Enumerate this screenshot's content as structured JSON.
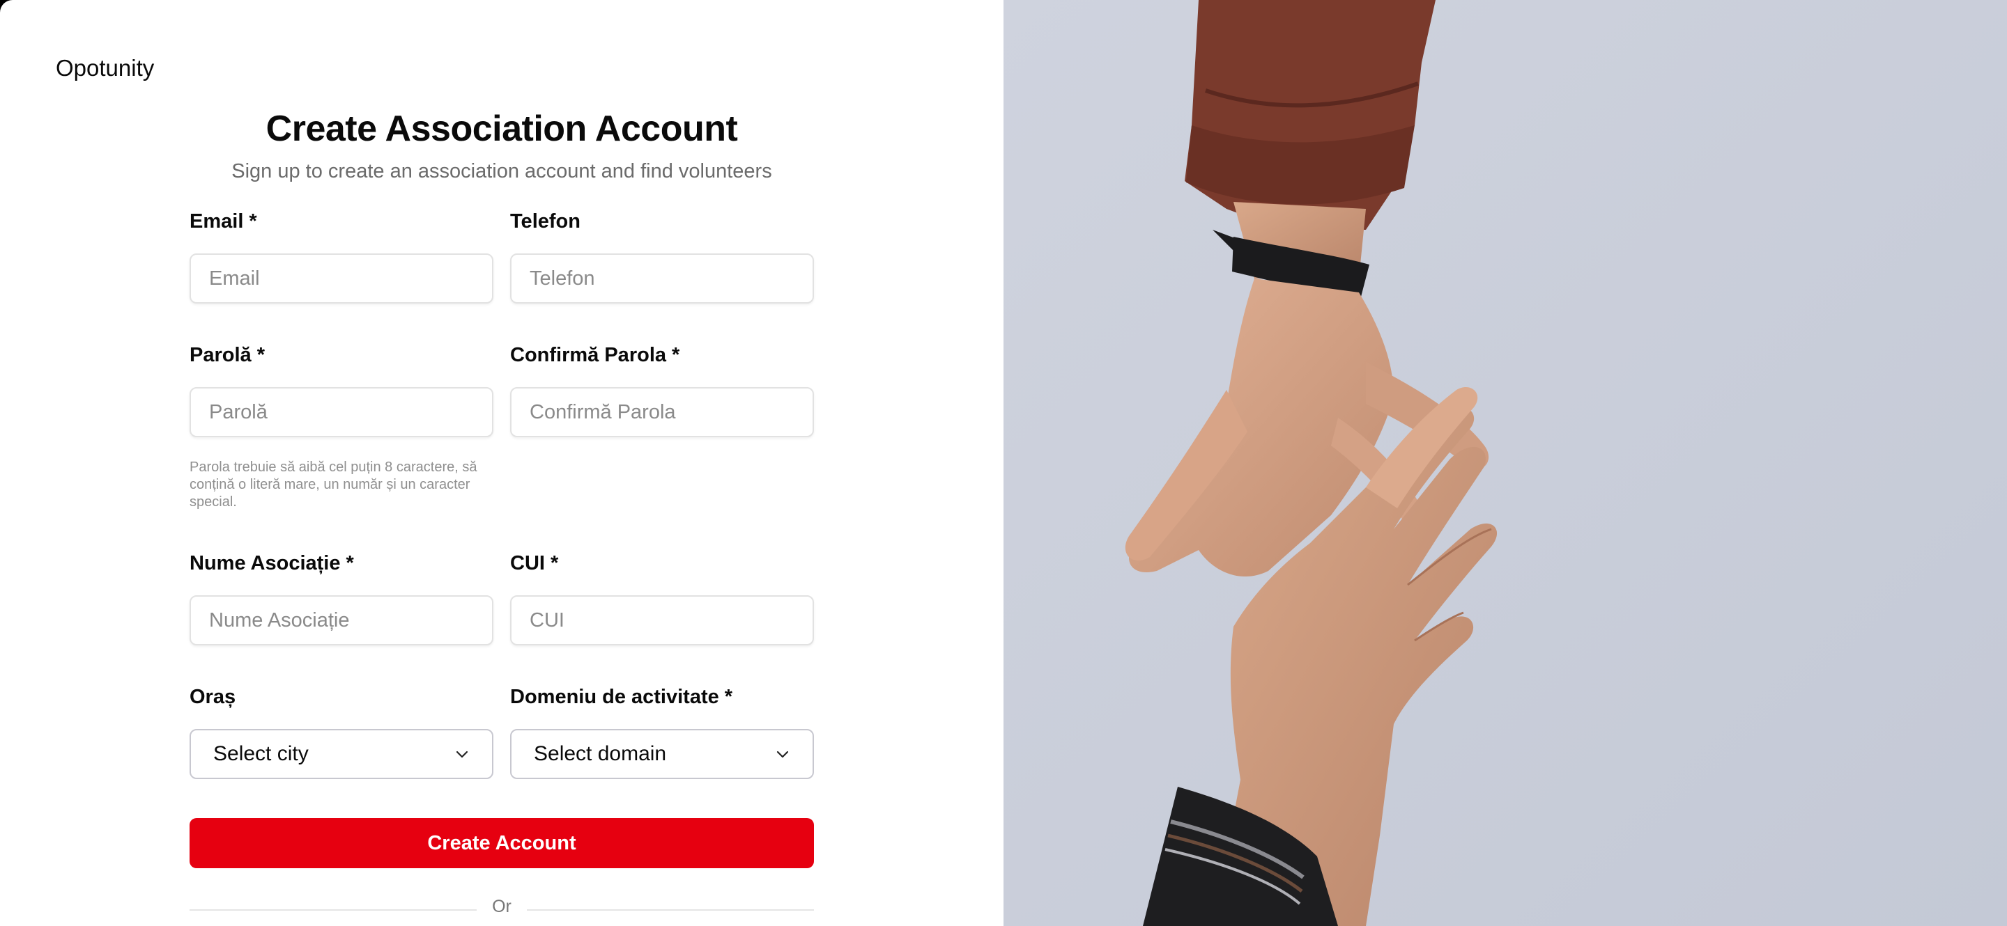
{
  "brand": "Opotunity",
  "title": "Create Association Account",
  "subtitle": "Sign up to create an association account and find volunteers",
  "fields": {
    "email": {
      "label": "Email *",
      "placeholder": "Email"
    },
    "phone": {
      "label": "Telefon",
      "placeholder": "Telefon"
    },
    "password": {
      "label": "Parolă *",
      "placeholder": "Parolă"
    },
    "confirm_password": {
      "label": "Confirmă Parola *",
      "placeholder": "Confirmă Parola"
    },
    "association_name": {
      "label": "Nume Asociație *",
      "placeholder": "Nume Asociație"
    },
    "cui": {
      "label": "CUI *",
      "placeholder": "CUI"
    },
    "city": {
      "label": "Oraș",
      "selected": "Select city"
    },
    "domain": {
      "label": "Domeniu de activitate *",
      "selected": "Select domain"
    }
  },
  "password_hint": "Parola trebuie să aibă cel puțin 8 caractere, să conțină o literă mare, un număr și un caracter special.",
  "submit_label": "Create Account",
  "divider_text": "Or",
  "colors": {
    "accent": "#e60010",
    "image_background": "#c9ceda",
    "sleeve": "#7a3a2c"
  },
  "icons": {
    "select_chevron": "chevron-down-icon"
  }
}
